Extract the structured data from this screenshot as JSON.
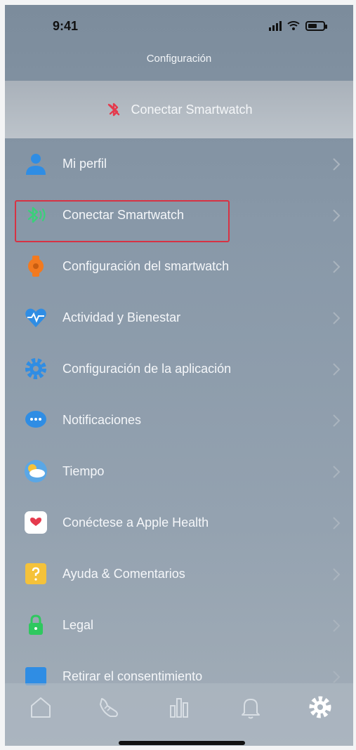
{
  "status_bar": {
    "time": "9:41"
  },
  "header": {
    "title": "Configuración"
  },
  "banner": {
    "label": "Conectar Smartwatch"
  },
  "menu": {
    "items": [
      {
        "label": "Mi perfil",
        "icon": "person-icon"
      },
      {
        "label": "Conectar Smartwatch",
        "icon": "bluetooth-icon"
      },
      {
        "label": "Configuración del smartwatch",
        "icon": "watch-settings-icon"
      },
      {
        "label": "Actividad y Bienestar",
        "icon": "heart-activity-icon"
      },
      {
        "label": "Configuración de la aplicación",
        "icon": "gear-icon"
      },
      {
        "label": "Notificaciones",
        "icon": "chat-bubble-icon"
      },
      {
        "label": "Tiempo",
        "icon": "weather-cloud-icon"
      },
      {
        "label": "Conéctese a Apple Health",
        "icon": "apple-health-icon"
      },
      {
        "label": "Ayuda & Comentarios",
        "icon": "help-icon"
      },
      {
        "label": "Legal",
        "icon": "lock-icon"
      },
      {
        "label": "Retirar el consentimiento",
        "icon": "consent-icon"
      }
    ]
  },
  "tabbar": {
    "tabs": [
      {
        "name": "home",
        "icon": "home-icon"
      },
      {
        "name": "activity",
        "icon": "shoe-icon"
      },
      {
        "name": "stats",
        "icon": "chart-icon"
      },
      {
        "name": "notifications",
        "icon": "bell-icon"
      },
      {
        "name": "settings",
        "icon": "gear-icon",
        "active": true
      }
    ]
  },
  "colors": {
    "highlight": "#d73243",
    "bluetooth": "#3ad07a",
    "profile": "#2f8de4",
    "watch": "#f37a1f",
    "gear": "#2f8de4",
    "health": "#e53a4d",
    "help": "#f5c23a",
    "legal": "#2fc85f"
  }
}
